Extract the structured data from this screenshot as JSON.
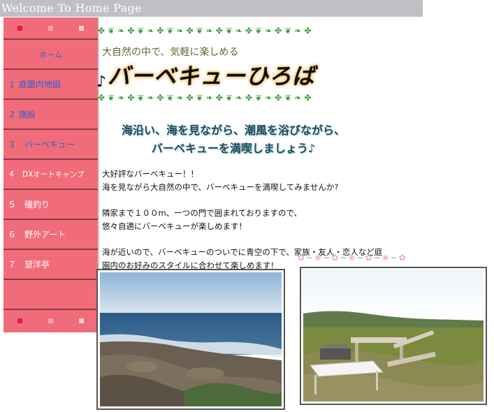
{
  "header": {
    "title": "Welcome To Home Page"
  },
  "nav": {
    "items": [
      {
        "label": "ホーム"
      },
      {
        "label": "１ 庭園内地図"
      },
      {
        "label": "２ 施設"
      },
      {
        "label": "３　バーベキュー"
      },
      {
        "label": "４　DXオートキャンプ"
      },
      {
        "label": "５　磯釣り"
      },
      {
        "label": "６　野外アート"
      },
      {
        "label": "７　望洋亭"
      }
    ]
  },
  "hero": {
    "tagline": "大自然の中で、気軽に楽しめる",
    "logo_note": "♪",
    "logo_text": "バーベキューひろば",
    "headline_line1": "海沿い、海を見ながら、潮風を浴びながら、",
    "headline_line2": "バーベキューを満喫しましょう♪"
  },
  "content": {
    "paragraphs": [
      {
        "line1": "大好評なバーベキュー！！",
        "line2": "海を見ながら大自然の中で、バーベキューを満喫してみませんか?"
      },
      {
        "line1": "隣家まで１００m、一つの門で囲まれておりますので、",
        "line2": "悠々自適にバーベキューが楽しめます！"
      },
      {
        "line1": "海が近いので、バーベキューのついでに青空の下で、家族・友人・恋人など庭",
        "line2": "園内のお好みのスタイルに合わせて楽しめます!"
      }
    ]
  },
  "colors": {
    "sidebar": "#f16c7a",
    "topbar": "#c0c0c4",
    "vine": "#3aa040",
    "nav_link": "#2b5fcf"
  },
  "icons": {
    "decor_vine": "leaf-garland",
    "decor_flowers": "flower-garland"
  }
}
